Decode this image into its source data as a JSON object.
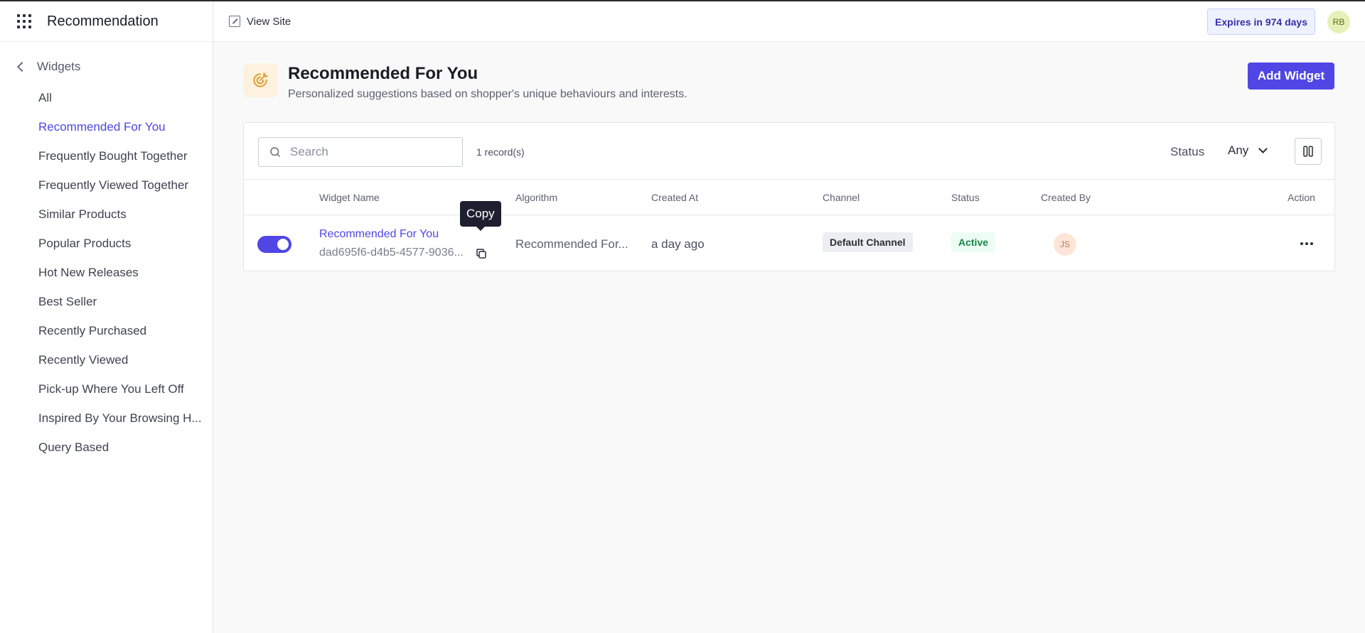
{
  "app": {
    "title": "Recommendation"
  },
  "sidebar": {
    "back_label": "Widgets",
    "items": [
      {
        "label": "All"
      },
      {
        "label": "Recommended For You"
      },
      {
        "label": "Frequently Bought Together"
      },
      {
        "label": "Frequently Viewed Together"
      },
      {
        "label": "Similar Products"
      },
      {
        "label": "Popular Products"
      },
      {
        "label": "Hot New Releases"
      },
      {
        "label": "Best Seller"
      },
      {
        "label": "Recently Purchased"
      },
      {
        "label": "Recently Viewed"
      },
      {
        "label": "Pick-up Where You Left Off"
      },
      {
        "label": "Inspired By Your Browsing H..."
      },
      {
        "label": "Query Based"
      }
    ],
    "active_index": 1
  },
  "topbar": {
    "view_site": "View Site",
    "expires": "Expires in 974 days",
    "user_initials": "RB"
  },
  "page": {
    "title": "Recommended For You",
    "subtitle": "Personalized suggestions based on shopper's unique behaviours and interests.",
    "add_button": "Add Widget"
  },
  "toolbar": {
    "search_placeholder": "Search",
    "records": "1 record(s)",
    "status_label": "Status",
    "status_value": "Any"
  },
  "table": {
    "columns": [
      "Widget Name",
      "Algorithm",
      "Created At",
      "Channel",
      "Status",
      "Created By",
      "Action"
    ],
    "rows": [
      {
        "enabled": true,
        "name": "Recommended For You",
        "id": "dad695f6-d4b5-4577-9036...",
        "algorithm": "Recommended For...",
        "created_at": "a day ago",
        "channel": "Default Channel",
        "status": "Active",
        "created_by": "JS"
      }
    ]
  },
  "tooltip": {
    "copy": "Copy"
  },
  "colors": {
    "accent": "#4f46e5",
    "status_active_text": "#16854a",
    "status_active_bg": "#ecfdf3",
    "page_icon": "#e0a33a"
  }
}
